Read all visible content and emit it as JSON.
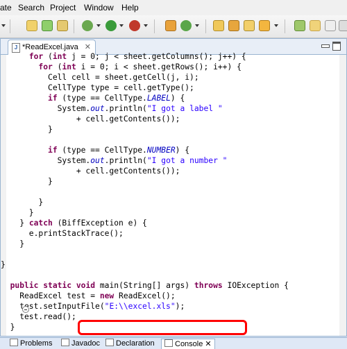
{
  "menubar": {
    "items": [
      "ate",
      "Search",
      "Project",
      "Window",
      "Help"
    ]
  },
  "toolbar": {
    "icons": [
      "new-package-icon",
      "new-class-icon",
      "open-file-icon",
      "debug-icon",
      "run-icon",
      "run-external-tool-icon",
      "open-type-icon",
      "search-icon",
      "open-task-icon",
      "annotation-icon",
      "marker-icon",
      "pen-icon",
      "toggle-mark-icon",
      "breadcrumb-icon",
      "back-icon"
    ]
  },
  "editor": {
    "tab_label": "*ReadExcel.java",
    "close_glyph": "✕",
    "highlight_color": "#ff0000",
    "code_lines": [
      "      for (int j = 0; j < sheet.getColumns(); j++) {",
      "        for (int i = 0; i < sheet.getRows(); i++) {",
      "          Cell cell = sheet.getCell(j, i);",
      "          CellType type = cell.getType();",
      "          if (type == CellType.LABEL) {",
      "            System.out.println(\"I got a label \"",
      "                + cell.getContents());",
      "          }",
      "",
      "          if (type == CellType.NUMBER) {",
      "            System.out.println(\"I got a number \"",
      "                + cell.getContents());",
      "          }",
      "",
      "        }",
      "      }",
      "    } catch (BiffException e) {",
      "      e.printStackTrace();",
      "    }",
      "",
      "}",
      "",
      "  public static void main(String[] args) throws IOException {",
      "    ReadExcel test = new ReadExcel();",
      "    test.setInputFile(\"E:\\\\excel.xls\");",
      "    test.read();",
      "  }",
      "}"
    ]
  },
  "bottom_tabs": [
    {
      "label": "Problems",
      "icon": "problems-icon"
    },
    {
      "label": "Javadoc",
      "icon": "javadoc-icon"
    },
    {
      "label": "Declaration",
      "icon": "declaration-icon"
    },
    {
      "label": "Console",
      "icon": "console-icon"
    }
  ],
  "bottom_close_glyph": "✕"
}
